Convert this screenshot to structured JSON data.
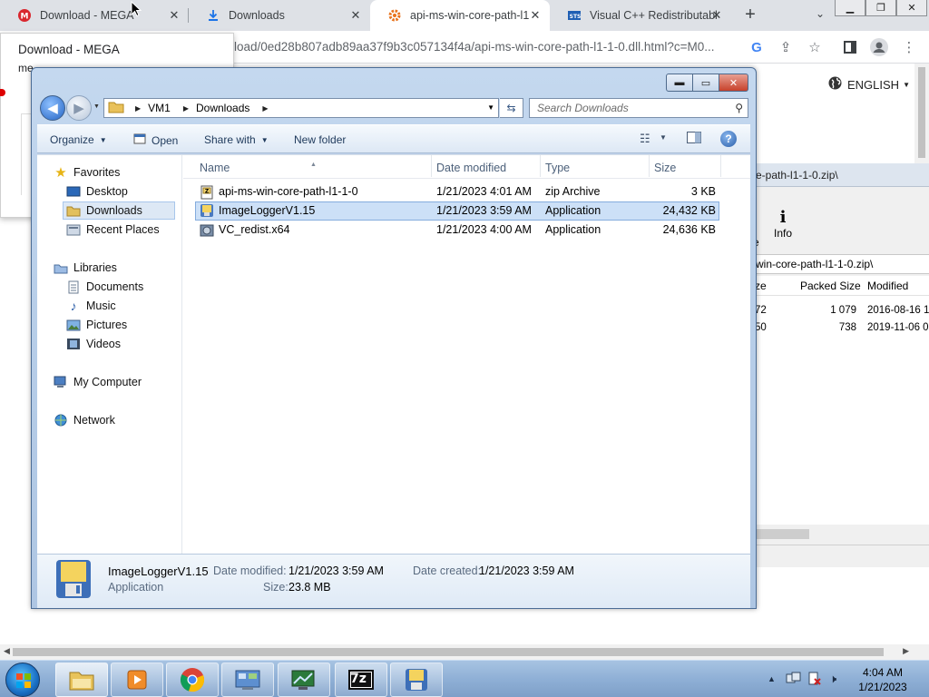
{
  "browser": {
    "tabs": [
      {
        "title": "Download - MEGA",
        "icon": "mega-icon"
      },
      {
        "title": "Downloads",
        "icon": "download-icon"
      },
      {
        "title": "api-ms-win-core-path-l1",
        "icon": "site-gear-icon"
      },
      {
        "title": "Visual C++ Redistributabl",
        "icon": "site-logo-icon"
      }
    ],
    "url_visible": "load/0ed28b807adb89aa37f9b3c057134f4a/api-ms-win-core-path-l1-1-0.dll.html?c=M0...",
    "language_selector": "ENGLISH",
    "mega_popup": {
      "title": "Download - MEGA",
      "snippet": "me"
    }
  },
  "sevenzip": {
    "path_top": "e-path-l1-1-0.zip\\",
    "info_button": "Info",
    "path_list": "win-core-path-l1-1-0.zip\\",
    "columns": [
      "ze",
      "Packed Size",
      "Modified"
    ],
    "rows": [
      {
        "size": "72",
        "packed": "1 079",
        "modified": "2016-08-16 1"
      },
      {
        "size": "50",
        "packed": "738",
        "modified": "2019-11-06 0"
      }
    ]
  },
  "explorer": {
    "breadcrumb": [
      "VM1",
      "Downloads"
    ],
    "search_placeholder": "Search Downloads",
    "commands": {
      "organize": "Organize",
      "open": "Open",
      "share_with": "Share with",
      "new_folder": "New folder"
    },
    "nav": {
      "favorites_label": "Favorites",
      "favorites": [
        "Desktop",
        "Downloads",
        "Recent Places"
      ],
      "libraries_label": "Libraries",
      "libraries": [
        "Documents",
        "Music",
        "Pictures",
        "Videos"
      ],
      "computer": "My Computer",
      "network": "Network"
    },
    "columns": {
      "name": "Name",
      "date": "Date modified",
      "type": "Type",
      "size": "Size"
    },
    "files": [
      {
        "name": "api-ms-win-core-path-l1-1-0",
        "date": "1/21/2023 4:01 AM",
        "type": "zip Archive",
        "size": "3 KB",
        "icon": "zip-icon"
      },
      {
        "name": "ImageLoggerV1.15",
        "date": "1/21/2023 3:59 AM",
        "type": "Application",
        "size": "24,432 KB",
        "icon": "exe-icon"
      },
      {
        "name": "VC_redist.x64",
        "date": "1/21/2023 4:00 AM",
        "type": "Application",
        "size": "24,636 KB",
        "icon": "installer-icon"
      }
    ],
    "details": {
      "name": "ImageLoggerV1.15",
      "type": "Application",
      "modified_label": "Date modified:",
      "modified": "1/21/2023 3:59 AM",
      "size_label": "Size:",
      "size": "23.8 MB",
      "created_label": "Date created:",
      "created": "1/21/2023 3:59 AM"
    }
  },
  "taskbar": {
    "items": [
      "explorer-icon",
      "media-player-icon",
      "chrome-icon",
      "control-panel-icon",
      "monitor-icon",
      "7zip-icon",
      "floppy-app-icon"
    ],
    "sevenzip_label": "7z",
    "time": "4:04 AM",
    "date": "1/21/2023"
  }
}
